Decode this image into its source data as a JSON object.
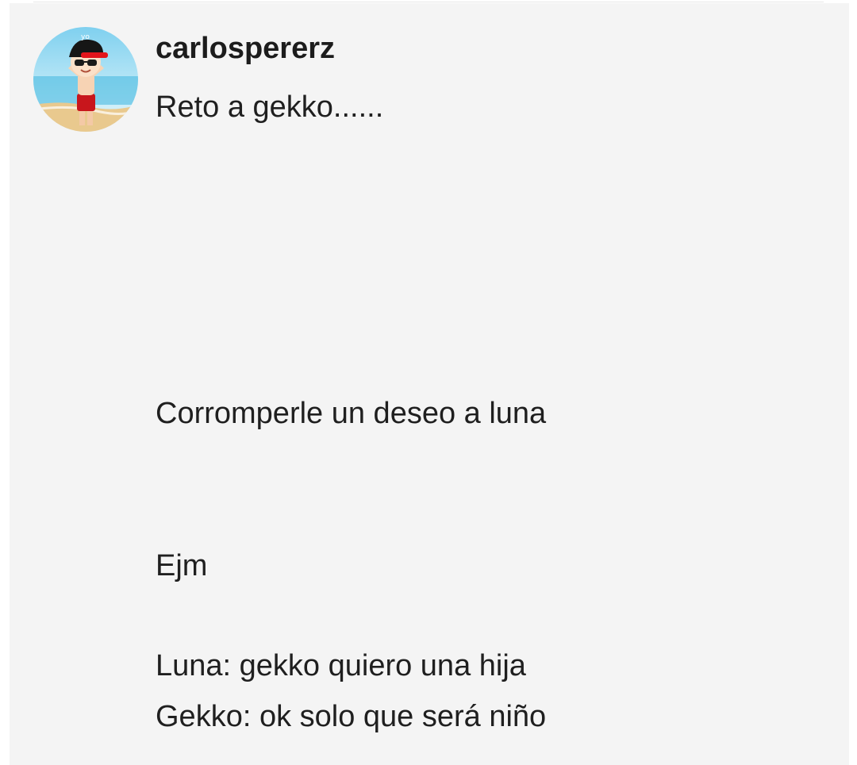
{
  "post": {
    "author": {
      "username": "carlospererz",
      "avatar_icon": "beach-character-avatar",
      "avatar_label": "yo"
    },
    "lines": [
      "Reto a gekko......",
      "Corromperle un deseo a luna",
      "Ejm",
      "Luna: gekko quiero una hija",
      "Gekko: ok solo que será niño"
    ]
  },
  "colors": {
    "card_background": "#f4f4f4",
    "text": "#1f1f1f",
    "username": "#1c1c1c"
  }
}
